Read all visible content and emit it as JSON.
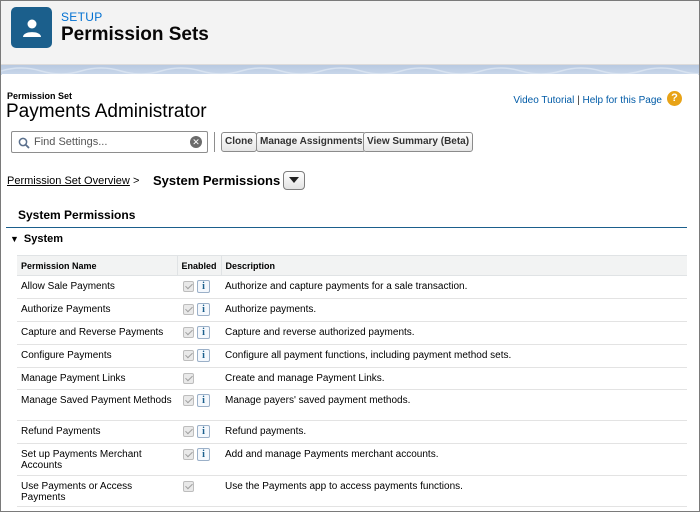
{
  "header": {
    "setup_label": "SETUP",
    "title": "Permission Sets",
    "icon": "user-icon",
    "icon_bg": "#1b5f8c"
  },
  "permission_set": {
    "type_label": "Permission Set",
    "name": "Payments Administrator"
  },
  "help": {
    "video_tutorial": "Video Tutorial",
    "separator": "|",
    "help_page": "Help for this Page",
    "help_icon": "?"
  },
  "search": {
    "placeholder": "Find Settings..."
  },
  "toolbar": {
    "clone": "Clone",
    "manage_assignments": "Manage Assignments",
    "view_summary": "View Summary (Beta)"
  },
  "breadcrumb": {
    "overview_link": "Permission Set Overview",
    "separator": ">",
    "current": "System Permissions"
  },
  "section": {
    "title": "System Permissions",
    "subsection": "System"
  },
  "table": {
    "headers": {
      "name": "Permission Name",
      "enabled": "Enabled",
      "description": "Description"
    },
    "rows": [
      {
        "name": "Allow Sale Payments",
        "enabled": true,
        "info": true,
        "description": "Authorize and capture payments for a sale transaction."
      },
      {
        "name": "Authorize Payments",
        "enabled": true,
        "info": true,
        "description": "Authorize payments."
      },
      {
        "name": "Capture and Reverse Payments",
        "enabled": true,
        "info": true,
        "description": "Capture and reverse authorized payments."
      },
      {
        "name": "Configure Payments",
        "enabled": true,
        "info": true,
        "description": "Configure all payment functions, including payment method sets."
      },
      {
        "name": "Manage Payment Links",
        "enabled": true,
        "info": false,
        "description": "Create and manage Payment Links."
      },
      {
        "name": "Manage Saved Payment Methods",
        "enabled": true,
        "info": true,
        "description": "Manage payers' saved payment methods."
      },
      {
        "name": "Refund Payments",
        "enabled": true,
        "info": true,
        "description": "Refund payments."
      },
      {
        "name": "Set up Payments Merchant Accounts",
        "enabled": true,
        "info": true,
        "description": "Add and manage Payments merchant accounts."
      },
      {
        "name": "Use Payments or Access Payments",
        "enabled": true,
        "info": false,
        "description": "Use the Payments app to access payments functions."
      }
    ]
  }
}
